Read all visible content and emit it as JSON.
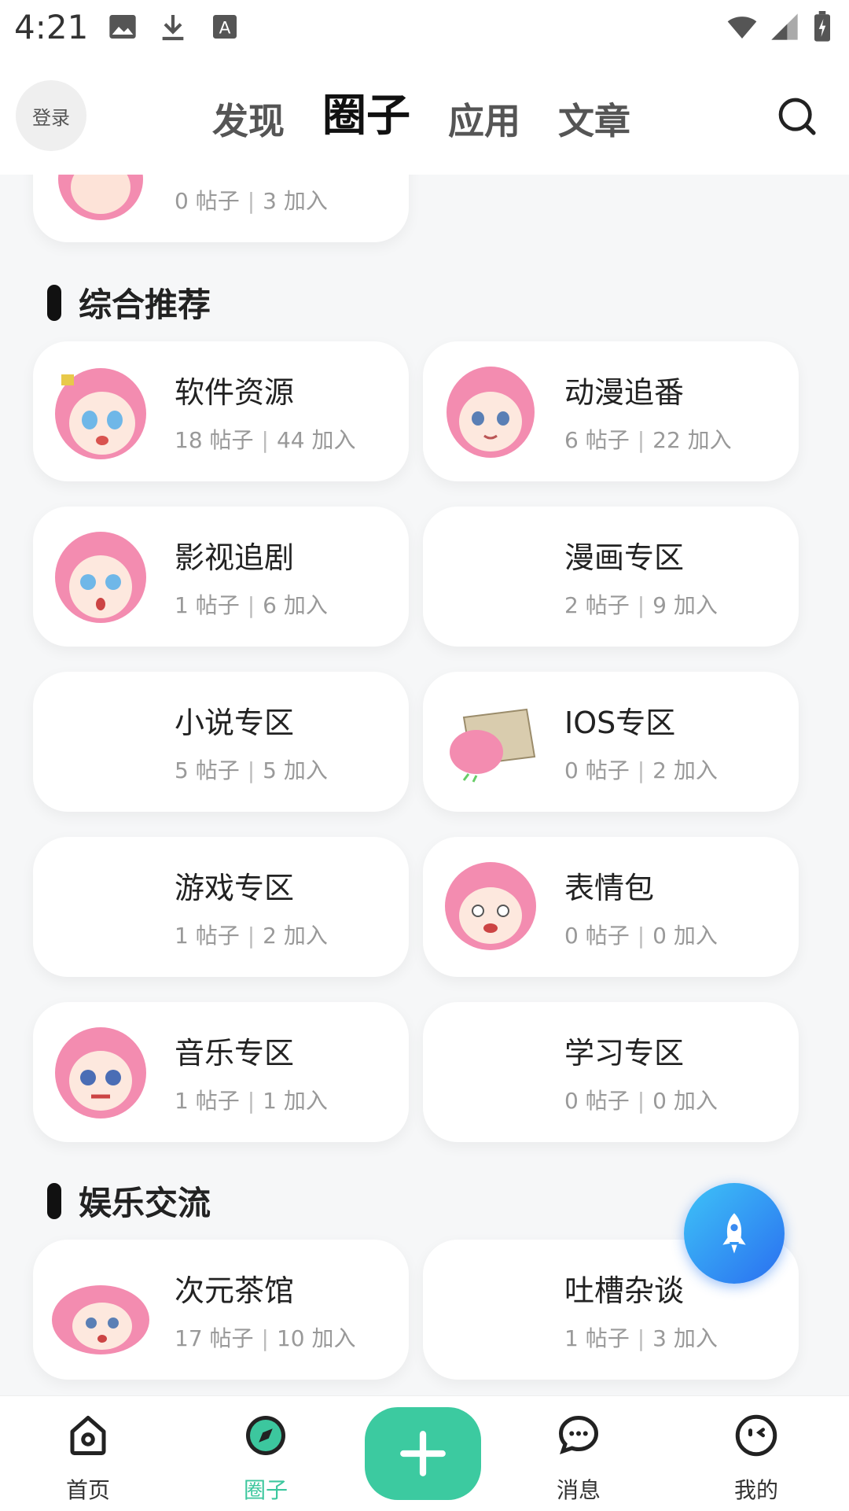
{
  "status_bar": {
    "time": "4:21"
  },
  "header": {
    "login_label": "登录",
    "tabs": [
      {
        "label": "发现"
      },
      {
        "label": "圈子"
      },
      {
        "label": "应用"
      },
      {
        "label": "文章"
      }
    ],
    "active_tab": "圈子"
  },
  "top_partial_card": {
    "stats": "0 帖子｜3 加入",
    "posts": "0 帖子",
    "joins": "3 加入"
  },
  "sections": [
    {
      "title": "综合推荐",
      "cards": [
        {
          "name": "软件资源",
          "posts": "18 帖子",
          "joins": "44 加入",
          "avatar": "anime-girl-avatar"
        },
        {
          "name": "动漫追番",
          "posts": "6 帖子",
          "joins": "22 加入",
          "avatar": "anime-girl-avatar"
        },
        {
          "name": "影视追剧",
          "posts": "1 帖子",
          "joins": "6 加入",
          "avatar": "anime-girl-avatar"
        },
        {
          "name": "漫画专区",
          "posts": "2 帖子",
          "joins": "9 加入",
          "avatar": ""
        },
        {
          "name": "小说专区",
          "posts": "5 帖子",
          "joins": "5 加入",
          "avatar": ""
        },
        {
          "name": "IOS专区",
          "posts": "0 帖子",
          "joins": "2 加入",
          "avatar": "anime-girl-box-avatar"
        },
        {
          "name": "游戏专区",
          "posts": "1 帖子",
          "joins": "2 加入",
          "avatar": ""
        },
        {
          "name": "表情包",
          "posts": "0 帖子",
          "joins": "0 加入",
          "avatar": "anime-girl-avatar"
        },
        {
          "name": "音乐专区",
          "posts": "1 帖子",
          "joins": "1 加入",
          "avatar": "anime-girl-avatar"
        },
        {
          "name": "学习专区",
          "posts": "0 帖子",
          "joins": "0 加入",
          "avatar": ""
        }
      ]
    },
    {
      "title": "娱乐交流",
      "cards": [
        {
          "name": "次元茶馆",
          "posts": "17 帖子",
          "joins": "10 加入",
          "avatar": "anime-girl-avatar"
        },
        {
          "name": "吐槽杂谈",
          "posts": "1 帖子",
          "joins": "3 加入",
          "avatar": ""
        }
      ]
    }
  ],
  "bottom_nav": [
    {
      "label": "首页",
      "icon": "home-icon"
    },
    {
      "label": "圈子",
      "icon": "compass-icon",
      "active": true
    },
    {
      "label": "消息",
      "icon": "chat-icon"
    },
    {
      "label": "我的",
      "icon": "profile-icon"
    }
  ],
  "colors": {
    "accent": "#3CC79E",
    "fab_start": "#3EC3F7",
    "fab_end": "#2A6FF0",
    "avatar_pink": "#F38CB0"
  }
}
